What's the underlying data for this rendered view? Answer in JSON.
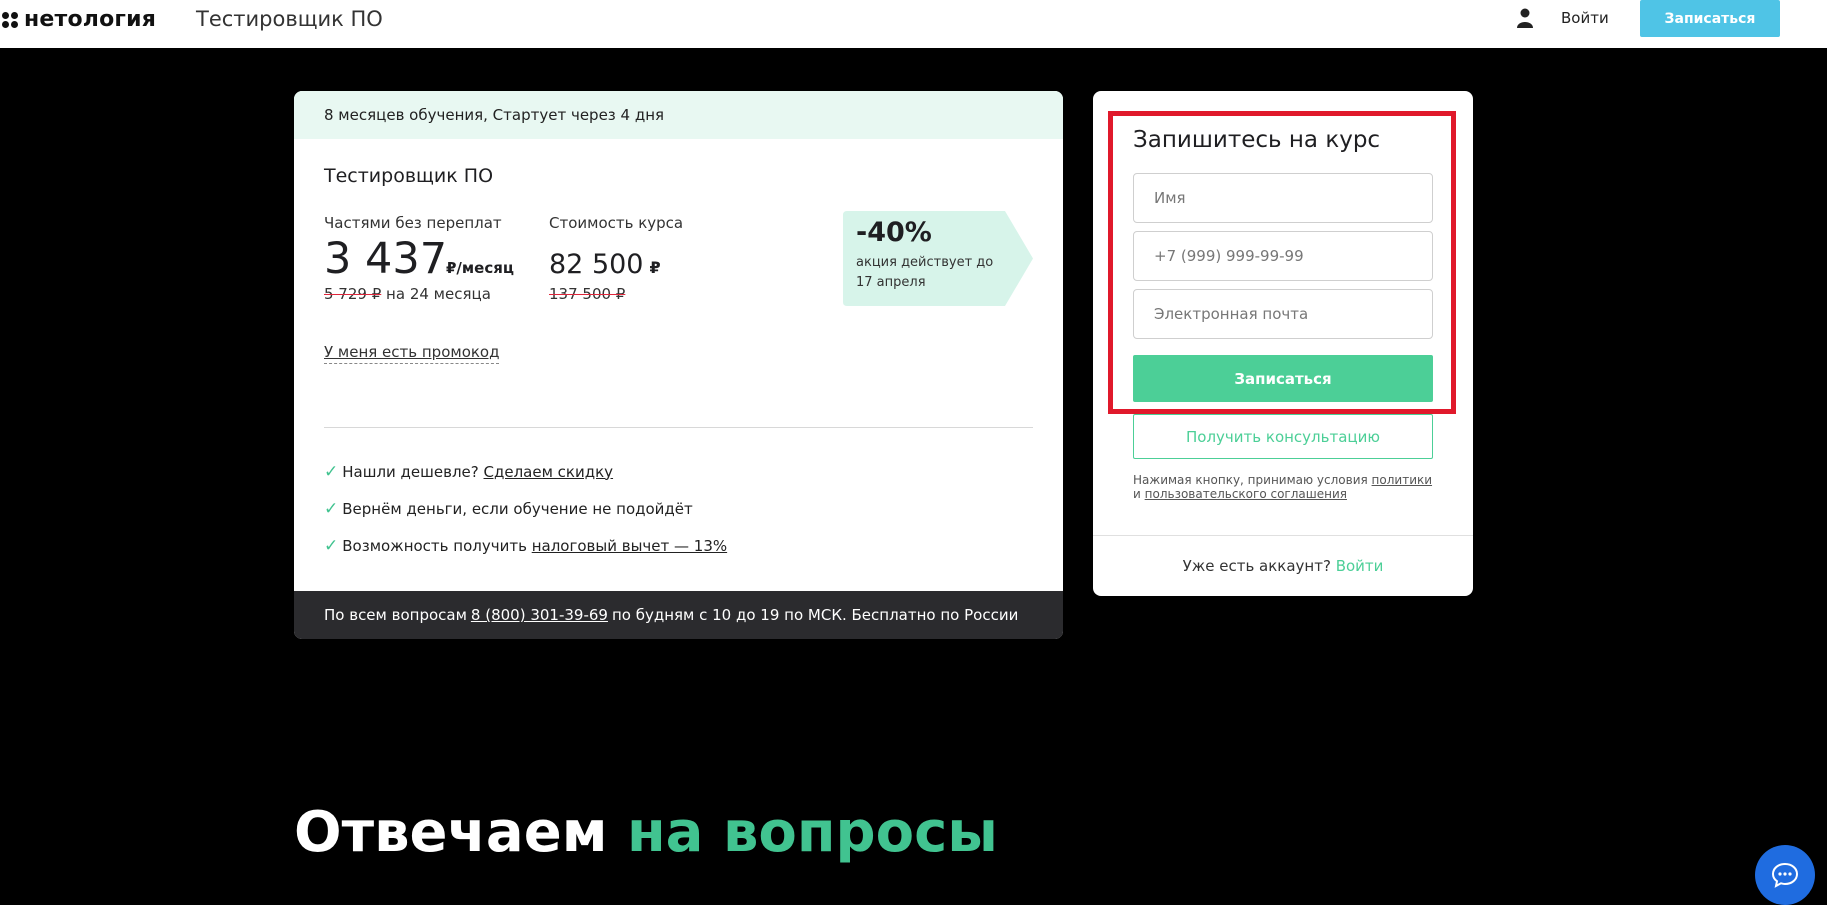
{
  "header": {
    "logo_text": "нетология",
    "course_title": "Тестировщик ПО",
    "login_label": "Войти",
    "signup_label": "Записаться"
  },
  "offer": {
    "top_info": "8 месяцев обучения, Стартует через 4 дня",
    "course_name": "Тестировщик ПО",
    "installment_label": "Частями без переплат",
    "installment_price": "3 437",
    "installment_unit": "₽/месяц",
    "installment_old": "5 729 ₽",
    "installment_term": "на 24 месяца",
    "cost_label": "Стоимость курса",
    "cost_price": "82 500",
    "cost_currency": "₽",
    "cost_old": "137 500 ₽",
    "discount_pct": "-40%",
    "discount_note": "акция действует до 17 апреля",
    "promo_link": "У меня есть промокод",
    "benefits": [
      {
        "text": "Нашли дешевле?",
        "link": "Сделаем скидку",
        "suffix": ""
      },
      {
        "text": "Вернём деньги, если обучение не подойдёт",
        "link": "",
        "suffix": ""
      },
      {
        "text": "Возможность получить",
        "link": "налоговый вычет — 13%",
        "suffix": ""
      }
    ],
    "bottom_prefix": "По всем вопросам",
    "bottom_phone": "8 (800) 301-39-69",
    "bottom_suffix": "по будням с 10 до 19 по МСК. Бесплатно по России"
  },
  "form": {
    "title": "Запишитесь на курс",
    "name_placeholder": "Имя",
    "phone_placeholder": "+7 (999) 999-99-99",
    "email_placeholder": "Электронная почта",
    "submit_label": "Записаться",
    "consult_label": "Получить консультацию",
    "terms_prefix": "Нажимая кнопку, принимаю условия",
    "terms_link1": "политики",
    "terms_and": "и",
    "terms_link2": "пользовательского соглашения",
    "account_text": "Уже есть аккаунт?",
    "account_link": "Войти"
  },
  "faq": {
    "heading_main": "Отвечаем",
    "heading_accent": "на вопросы"
  },
  "colors": {
    "accent_green": "#41c390",
    "header_button": "#4fc4e6",
    "highlight_red": "#e0192b",
    "chat_blue": "#1f6ce0"
  },
  "icons": [
    "user-icon",
    "check-icon",
    "chat-icon"
  ]
}
